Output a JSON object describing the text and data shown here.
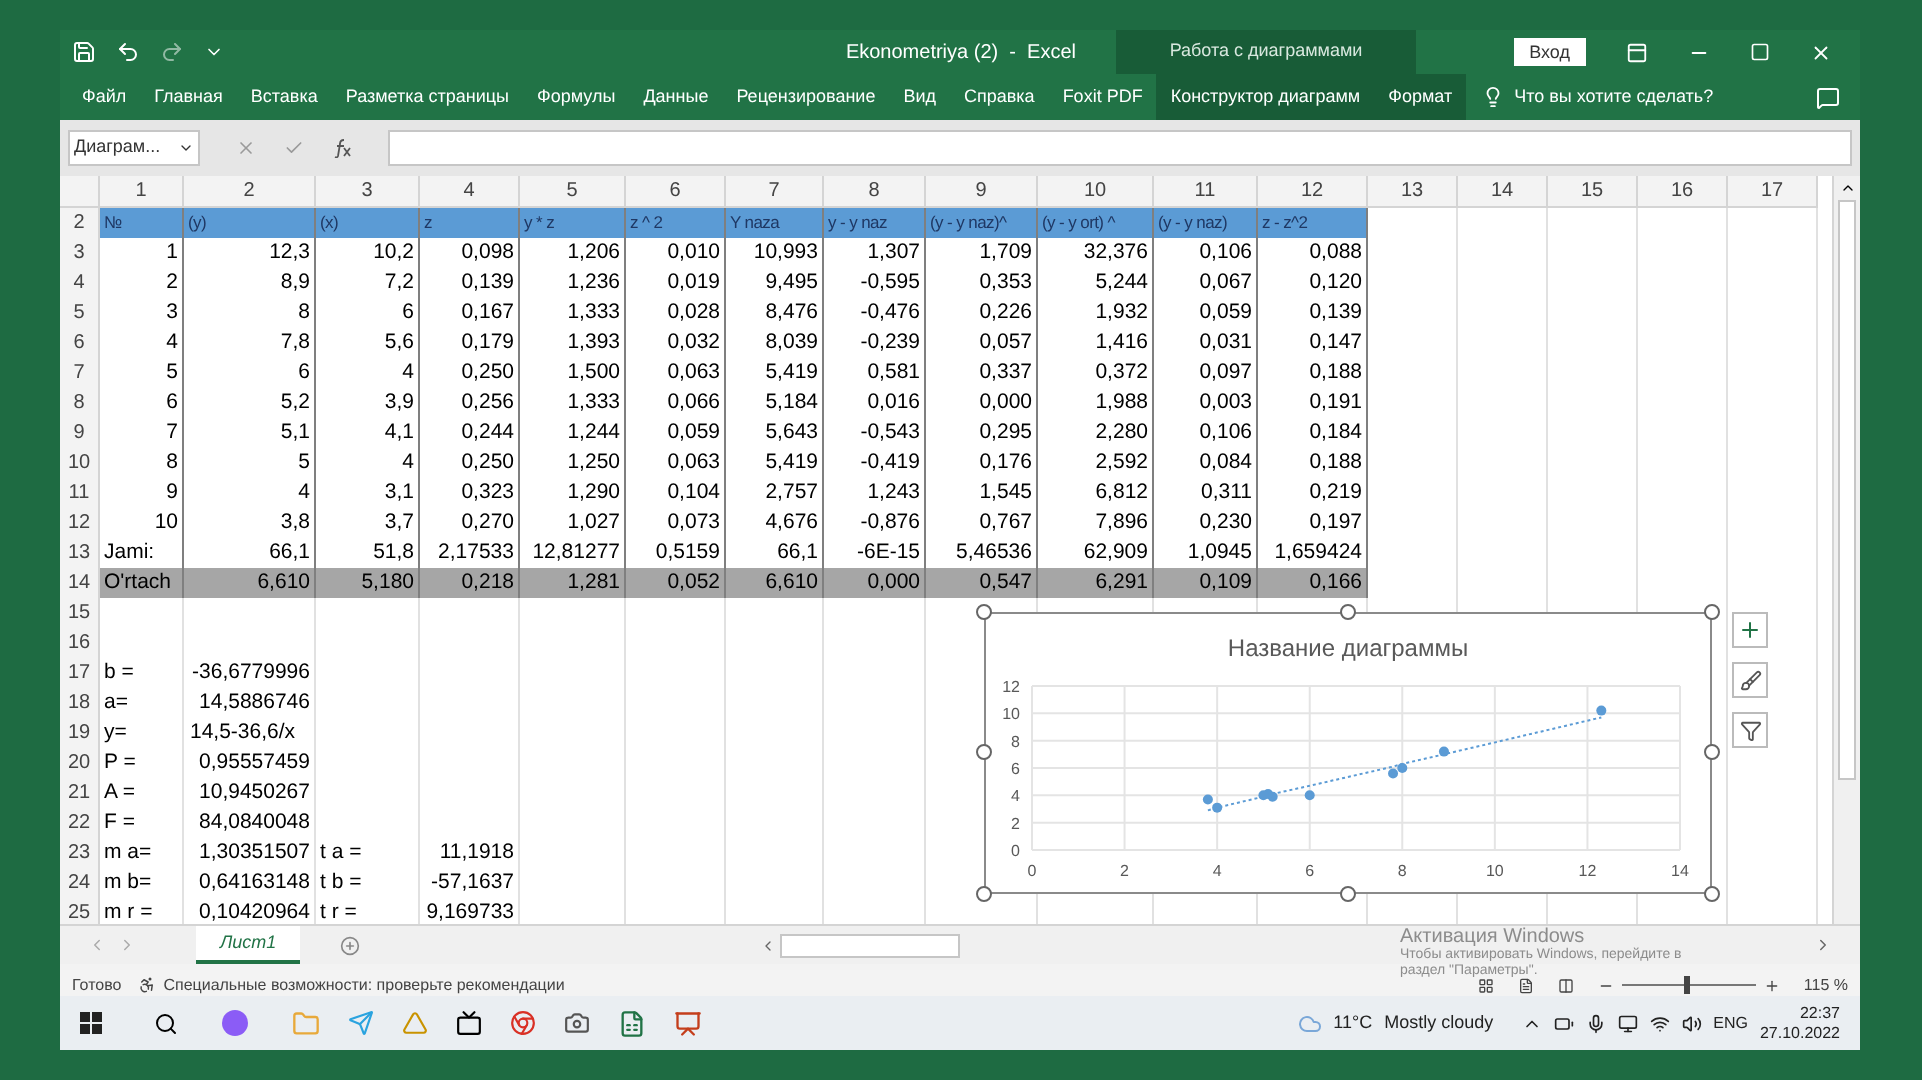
{
  "window": {
    "title": "Ekonometriya (2)  -  Excel",
    "context_title": "Работа с диаграммами",
    "sign_in": "Вход"
  },
  "ribbon": {
    "tabs": [
      {
        "label": "Файл",
        "kind": "standard"
      },
      {
        "label": "Главная",
        "kind": "standard"
      },
      {
        "label": "Вставка",
        "kind": "standard"
      },
      {
        "label": "Разметка страницы",
        "kind": "standard"
      },
      {
        "label": "Формулы",
        "kind": "standard"
      },
      {
        "label": "Данные",
        "kind": "standard"
      },
      {
        "label": "Рецензирование",
        "kind": "standard"
      },
      {
        "label": "Вид",
        "kind": "standard"
      },
      {
        "label": "Справка",
        "kind": "standard"
      },
      {
        "label": "Foxit PDF",
        "kind": "standard"
      },
      {
        "label": "Конструктор диаграмм",
        "kind": "contextual"
      },
      {
        "label": "Формат",
        "kind": "contextual"
      }
    ],
    "search": "Что вы хотите сделать?"
  },
  "formula_bar": {
    "name_box": "Диаграм..."
  },
  "sheet": {
    "columns": [
      "1",
      "2",
      "3",
      "4",
      "5",
      "6",
      "7",
      "8",
      "9",
      "10",
      "11",
      "12",
      "13",
      "14",
      "15",
      "16",
      "17"
    ],
    "rows": [
      {
        "number": "2",
        "kind": "header",
        "cells": [
          "№",
          "(y)",
          "(x)",
          "z",
          "y * z",
          "z ^ 2",
          "Y naza",
          "y - y naz",
          "(y - y naz)^",
          "(y - y ort) ^",
          "(y - y naz)",
          "z - z^2"
        ]
      },
      {
        "number": "3",
        "kind": "data",
        "cells": [
          "1",
          "12,3",
          "10,2",
          "0,098",
          "1,206",
          "0,010",
          "10,993",
          "1,307",
          "1,709",
          "32,376",
          "0,106",
          "0,088"
        ]
      },
      {
        "number": "4",
        "kind": "data",
        "cells": [
          "2",
          "8,9",
          "7,2",
          "0,139",
          "1,236",
          "0,019",
          "9,495",
          "-0,595",
          "0,353",
          "5,244",
          "0,067",
          "0,120"
        ]
      },
      {
        "number": "5",
        "kind": "data",
        "cells": [
          "3",
          "8",
          "6",
          "0,167",
          "1,333",
          "0,028",
          "8,476",
          "-0,476",
          "0,226",
          "1,932",
          "0,059",
          "0,139"
        ]
      },
      {
        "number": "6",
        "kind": "data",
        "cells": [
          "4",
          "7,8",
          "5,6",
          "0,179",
          "1,393",
          "0,032",
          "8,039",
          "-0,239",
          "0,057",
          "1,416",
          "0,031",
          "0,147"
        ]
      },
      {
        "number": "7",
        "kind": "data",
        "cells": [
          "5",
          "6",
          "4",
          "0,250",
          "1,500",
          "0,063",
          "5,419",
          "0,581",
          "0,337",
          "0,372",
          "0,097",
          "0,188"
        ]
      },
      {
        "number": "8",
        "kind": "data",
        "cells": [
          "6",
          "5,2",
          "3,9",
          "0,256",
          "1,333",
          "0,066",
          "5,184",
          "0,016",
          "0,000",
          "1,988",
          "0,003",
          "0,191"
        ]
      },
      {
        "number": "9",
        "kind": "data",
        "cells": [
          "7",
          "5,1",
          "4,1",
          "0,244",
          "1,244",
          "0,059",
          "5,643",
          "-0,543",
          "0,295",
          "2,280",
          "0,106",
          "0,184"
        ]
      },
      {
        "number": "10",
        "kind": "data",
        "cells": [
          "8",
          "5",
          "4",
          "0,250",
          "1,250",
          "0,063",
          "5,419",
          "-0,419",
          "0,176",
          "2,592",
          "0,084",
          "0,188"
        ]
      },
      {
        "number": "11",
        "kind": "data",
        "cells": [
          "9",
          "4",
          "3,1",
          "0,323",
          "1,290",
          "0,104",
          "2,757",
          "1,243",
          "1,545",
          "6,812",
          "0,311",
          "0,219"
        ]
      },
      {
        "number": "12",
        "kind": "data",
        "cells": [
          "10",
          "3,8",
          "3,7",
          "0,270",
          "1,027",
          "0,073",
          "4,676",
          "-0,876",
          "0,767",
          "7,896",
          "0,230",
          "0,197"
        ]
      },
      {
        "number": "13",
        "kind": "total",
        "cells": [
          "Jami:",
          "66,1",
          "51,8",
          "2,17533",
          "12,81277",
          "0,5159",
          "66,1",
          "-6E-15",
          "5,46536",
          "62,909",
          "1,0945",
          "1,659424"
        ]
      },
      {
        "number": "14",
        "kind": "average",
        "cells": [
          "O'rtach",
          "6,610",
          "5,180",
          "0,218",
          "1,281",
          "0,052",
          "6,610",
          "0,000",
          "0,547",
          "6,291",
          "0,109",
          "0,166"
        ]
      },
      {
        "number": "15",
        "kind": "blank",
        "cells": []
      },
      {
        "number": "16",
        "kind": "blank",
        "cells": []
      },
      {
        "number": "17",
        "kind": "result",
        "cells": [
          "b =",
          "-36,6779996"
        ]
      },
      {
        "number": "18",
        "kind": "result",
        "cells": [
          "a=",
          "14,5886746"
        ]
      },
      {
        "number": "19",
        "kind": "formula",
        "cells": [
          "y=",
          "14,5-36,6/x"
        ]
      },
      {
        "number": "20",
        "kind": "result",
        "cells": [
          "P =",
          "0,95557459"
        ]
      },
      {
        "number": "21",
        "kind": "result",
        "cells": [
          "A =",
          "10,9450267"
        ]
      },
      {
        "number": "22",
        "kind": "result",
        "cells": [
          "F =",
          "84,0840048"
        ]
      },
      {
        "number": "23",
        "kind": "result",
        "cells": [
          "m a=",
          "1,30351507",
          "t a =",
          "11,1918"
        ]
      },
      {
        "number": "24",
        "kind": "result",
        "cells": [
          "m b=",
          "0,64163148",
          "t b =",
          "-57,1637"
        ]
      },
      {
        "number": "25",
        "kind": "result",
        "cells": [
          "m r =",
          "0,10420964",
          "t r =",
          "9,169733"
        ]
      }
    ]
  },
  "chart": {
    "chart_data": {
      "type": "scatter",
      "title": "Название диаграммы",
      "grid": true,
      "xlim": [
        0,
        14
      ],
      "ylim": [
        0,
        12
      ],
      "xticks": [
        0,
        2,
        4,
        6,
        8,
        10,
        12,
        14
      ],
      "yticks": [
        0,
        2,
        4,
        6,
        8,
        10,
        12
      ],
      "x": [
        12.3,
        8.9,
        8,
        7.8,
        6,
        5.2,
        5.1,
        5,
        4,
        3.8
      ],
      "series": [
        {
          "type": "scatter",
          "color": "#5b9bd5",
          "values": [
            10.2,
            7.2,
            6,
            5.6,
            4,
            3.9,
            4.1,
            4,
            3.1,
            3.7
          ]
        },
        {
          "type": "line",
          "color": "#5b9bd5",
          "line_style": "dotted",
          "values": [
            9.7,
            7,
            6.3,
            6.1,
            4.7,
            4.1,
            4,
            3.9,
            3.1,
            2.9
          ]
        }
      ]
    }
  },
  "sheet_tabs": [
    {
      "label": "Лист1",
      "selected": true
    }
  ],
  "status_bar": {
    "ready": "Готово",
    "accessibility": "Специальные возможности: проверьте рекомендации",
    "zoom": {
      "level": 0.48,
      "reading": "115 %"
    }
  },
  "activation": {
    "title": "Активация Windows",
    "lines": [
      "Чтобы активировать Windows, перейдите в",
      "раздел \"Параметры\"."
    ]
  },
  "taskbar": {
    "temperature": "11°C",
    "weather": "Mostly cloudy",
    "language": "ENG",
    "time": "22:37",
    "date": "27.10.2022"
  }
}
